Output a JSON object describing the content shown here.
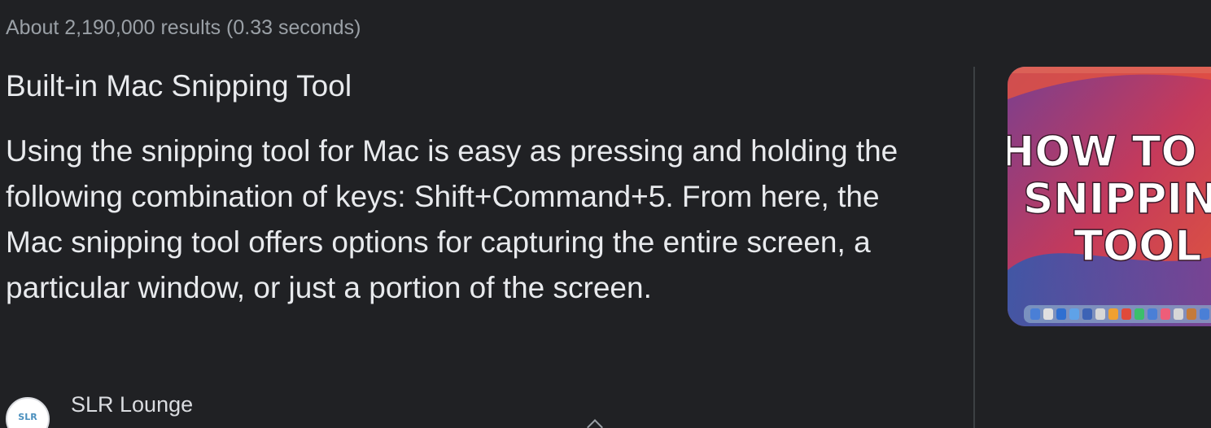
{
  "results": {
    "stats": "About 2,190,000 results (0.33 seconds)"
  },
  "featured_snippet": {
    "title": "Built-in Mac Snipping Tool",
    "text": "Using the snipping tool for Mac is easy as pressing and holding the following combination of keys: Shift+Command+5. From here, the Mac snipping tool offers options for capturing the entire screen, a particular window, or just a portion of the screen.",
    "thumbnail": {
      "lines": [
        "HOW TO US",
        "SNIPPING",
        "TOOL"
      ]
    },
    "source": {
      "name": "SLR Lounge",
      "favicon_text": "SLR",
      "favicon_icon": "slr-lounge-logo-icon"
    }
  },
  "colors": {
    "background": "#202124",
    "text_primary": "#e8eaed",
    "text_secondary": "#9aa0a6",
    "divider": "#3c4043"
  }
}
